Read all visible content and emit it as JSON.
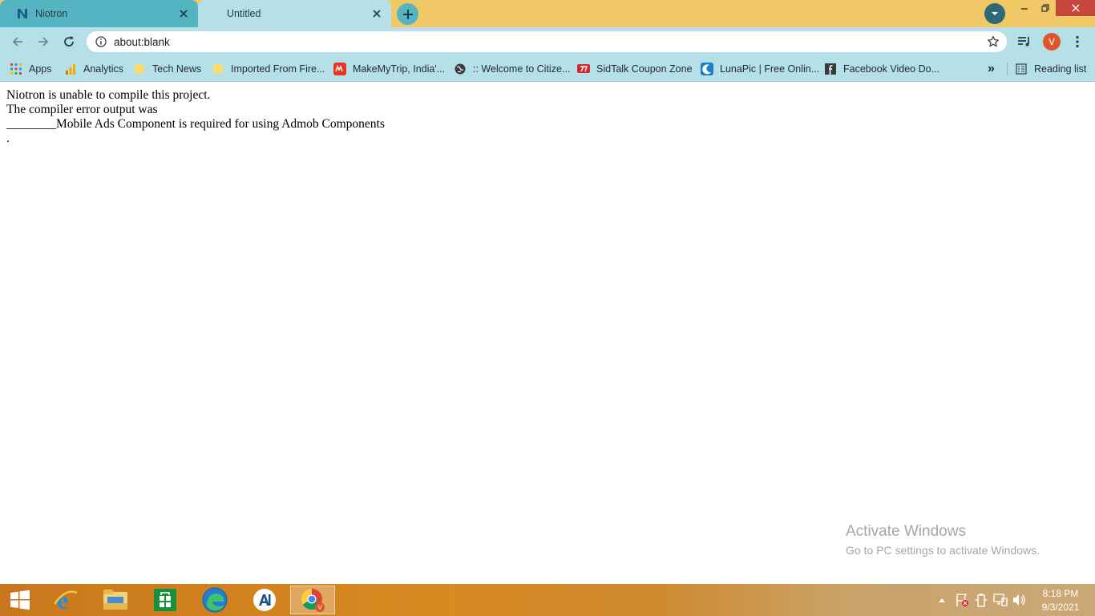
{
  "browser": {
    "tabs": [
      {
        "title": "Niotron",
        "active": false
      },
      {
        "title": "Untitled",
        "active": true
      }
    ],
    "address": "about:blank",
    "profile_initial": "V",
    "bookmarks": [
      {
        "label": "Apps",
        "icon": "apps-grid-icon"
      },
      {
        "label": "Analytics",
        "icon": "analytics-icon"
      },
      {
        "label": "Tech News",
        "icon": "folder-icon"
      },
      {
        "label": "Imported From Fire...",
        "icon": "folder-icon"
      },
      {
        "label": "MakeMyTrip, India'...",
        "icon": "makemytrip-icon"
      },
      {
        "label": ":: Welcome to Citize...",
        "icon": "globe-icon"
      },
      {
        "label": "SidTalk Coupon Zone",
        "icon": "sidtalk-icon"
      },
      {
        "label": "LunaPic | Free Onlin...",
        "icon": "lunapic-icon"
      },
      {
        "label": "Facebook Video Do...",
        "icon": "facebook-icon"
      }
    ],
    "reading_list": "Reading list",
    "more_bookmarks": "»"
  },
  "page": {
    "line1": "Niotron is unable to compile this project.",
    "line2": "The compiler error output was",
    "line3": "________Mobile Ads Component is required for using Admob Components",
    "line4": "."
  },
  "watermark": {
    "title": "Activate Windows",
    "subtitle": "Go to PC settings to activate Windows."
  },
  "taskbar": {
    "time": "8:18 PM",
    "date": "9/3/2021"
  },
  "colors": {
    "tab_strip": "#f0c866",
    "toolbar": "#b6e0e7",
    "active_accent": "#54b4c2",
    "close_button": "#c7463c",
    "avatar": "#e0542a"
  }
}
